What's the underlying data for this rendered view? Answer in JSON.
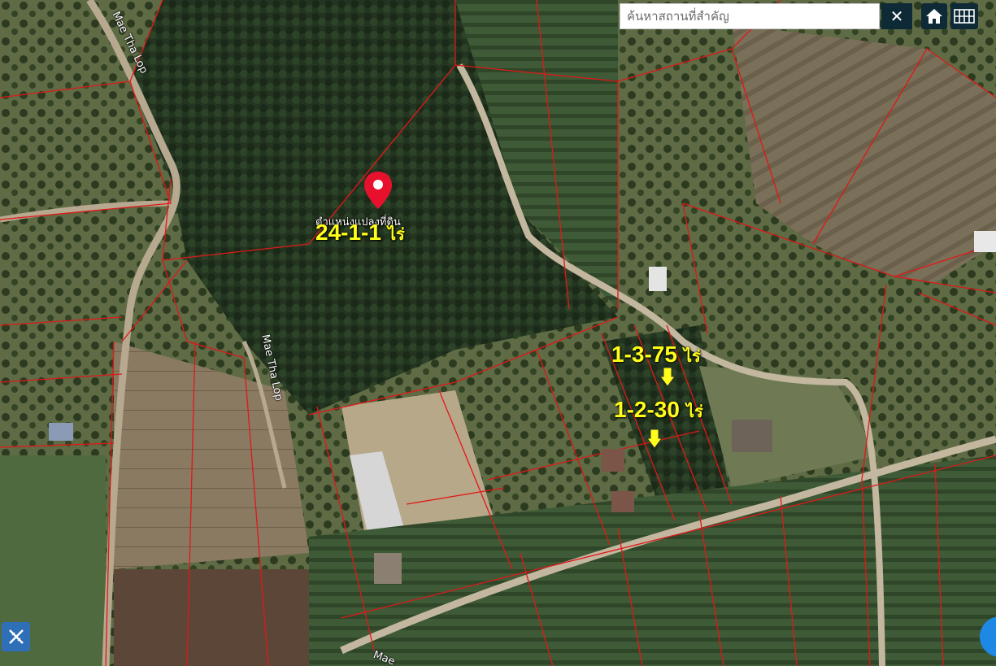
{
  "search": {
    "placeholder": "ค้นหาสถานที่สำคัญ",
    "clear_label": "✕"
  },
  "controls": {
    "home_icon": "home-icon",
    "grid_icon": "grid-icon",
    "tool_icon": "ruler-pencil-icon"
  },
  "roads": [
    {
      "name": "Mae Tha Lop"
    },
    {
      "name": "Mae Tha Lop"
    },
    {
      "name": "Mae"
    }
  ],
  "marker": {
    "label": "ตำแหน่งแปลงที่ดิน",
    "icon": "map-pin-icon",
    "color": "#e8112d"
  },
  "parcels": [
    {
      "area": "24-1-1",
      "unit": "ไร่"
    },
    {
      "area": "1-3-75",
      "unit": "ไร่"
    },
    {
      "area": "1-2-30",
      "unit": "ไร่"
    }
  ],
  "colors": {
    "parcel_line": "#e01818",
    "label": "#ffff1a",
    "control_bg": "#0e2a36",
    "tool_bg": "#2f6fb8"
  }
}
